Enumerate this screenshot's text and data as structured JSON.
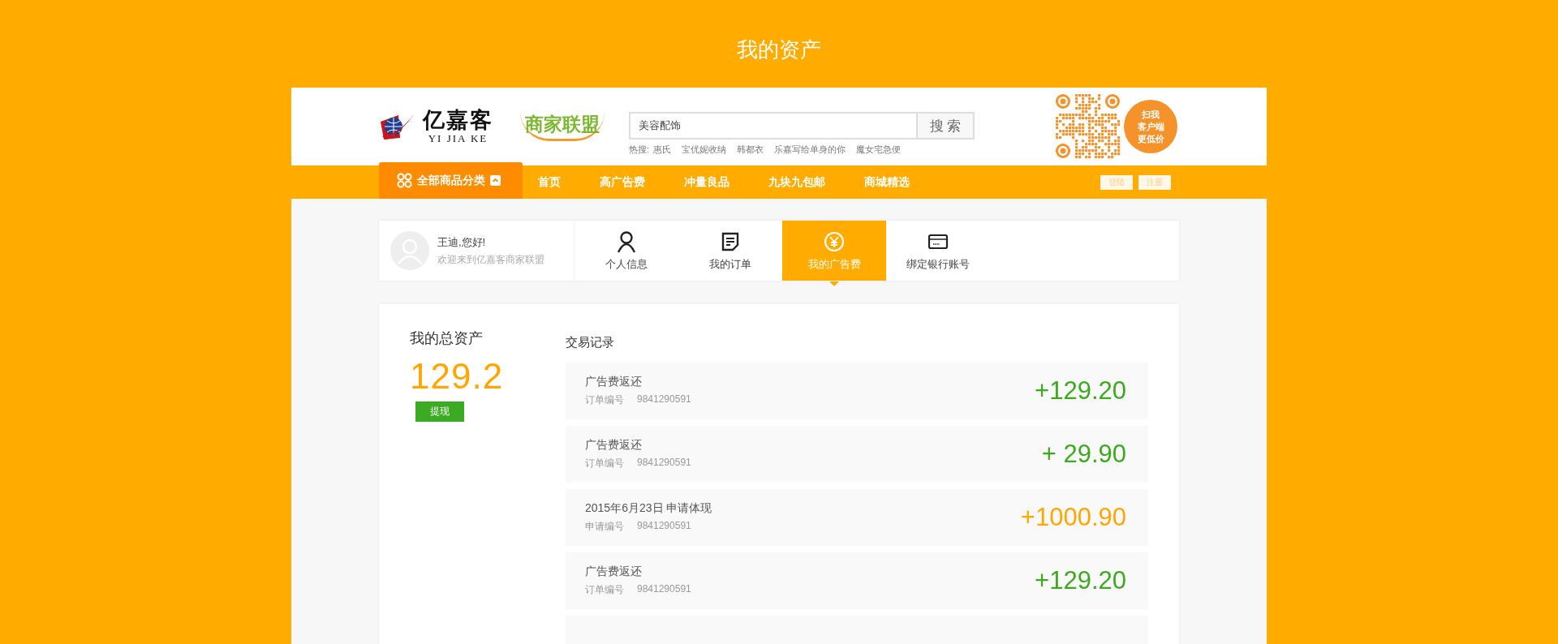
{
  "page_title": "我的资产",
  "header": {
    "logo": {
      "name": "亿嘉客",
      "pinyin": "YI JIA KE",
      "sub": "商家联盟"
    },
    "search": {
      "value": "美容配饰",
      "button": "搜 索"
    },
    "hot": {
      "label": "热搜:",
      "items": [
        "惠氏",
        "宝优妮收纳",
        "韩都衣",
        "乐嘉写给单身的你",
        "魔女宅急便"
      ]
    },
    "qr_bubble": [
      "扫我",
      "客户端",
      "更低价"
    ]
  },
  "nav": {
    "category": "全部商品分类",
    "items": [
      "首页",
      "高广告费",
      "冲量良品",
      "九块九包邮",
      "商城精选"
    ],
    "account": [
      "登陆",
      "注册"
    ]
  },
  "profile": {
    "greeting": "王迪,您好!",
    "welcome": "欢迎来到亿嘉客商家联盟",
    "tabs": [
      {
        "label": "个人信息",
        "kind": "person",
        "selected": false
      },
      {
        "label": "我的订单",
        "kind": "order",
        "selected": false
      },
      {
        "label": "我的广告费",
        "kind": "yen",
        "selected": true
      },
      {
        "label": "绑定银行账号",
        "kind": "card",
        "selected": false
      }
    ]
  },
  "assets": {
    "label": "我的总资产",
    "total": "129.2",
    "withdraw": "提现"
  },
  "records": {
    "title": "交易记录",
    "rows": [
      {
        "kind": "rebate",
        "title": "广告费返还",
        "id_label": "订单编号",
        "id": "9841290591",
        "amount": "+129.20"
      },
      {
        "kind": "rebate",
        "title": "广告费返还",
        "id_label": "订单编号",
        "id": "9841290591",
        "amount": "+ 29.90"
      },
      {
        "kind": "withdrawal",
        "title": "2015年6月23日 申请体现",
        "id_label": "申请编号",
        "id": "9841290591",
        "amount": "+1000.90"
      },
      {
        "kind": "rebate",
        "title": "广告费返还",
        "id_label": "订单编号",
        "id": "9841290591",
        "amount": "+129.20"
      },
      {
        "kind": "blank"
      }
    ]
  }
}
